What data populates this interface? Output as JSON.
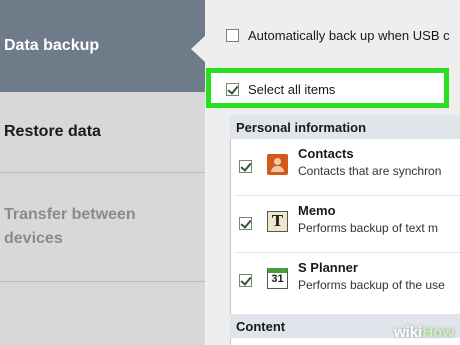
{
  "sidebar": {
    "items": [
      {
        "label": "Data backup"
      },
      {
        "label": "Restore data"
      },
      {
        "label": "Transfer between devices"
      }
    ]
  },
  "options": {
    "auto_backup_label": "Automatically back up when USB c",
    "select_all_label": "Select all items"
  },
  "sections": [
    {
      "title": "Personal information",
      "items": [
        {
          "title": "Contacts",
          "desc": "Contacts that are synchron",
          "icon": "contacts-icon",
          "checked": true
        },
        {
          "title": "Memo",
          "desc": "Performs backup of text m",
          "icon": "memo-icon",
          "icon_text": "T",
          "checked": true
        },
        {
          "title": "S Planner",
          "desc": "Performs backup of the use",
          "icon": "calendar-icon",
          "icon_text": "31",
          "checked": true
        }
      ]
    },
    {
      "title": "Content"
    }
  ],
  "watermark": {
    "part1": "wiki",
    "part2": "How"
  },
  "colors": {
    "sidebar_active": "#6e7b88",
    "highlight": "#26e01f",
    "section_header": "#dfe5ea"
  }
}
